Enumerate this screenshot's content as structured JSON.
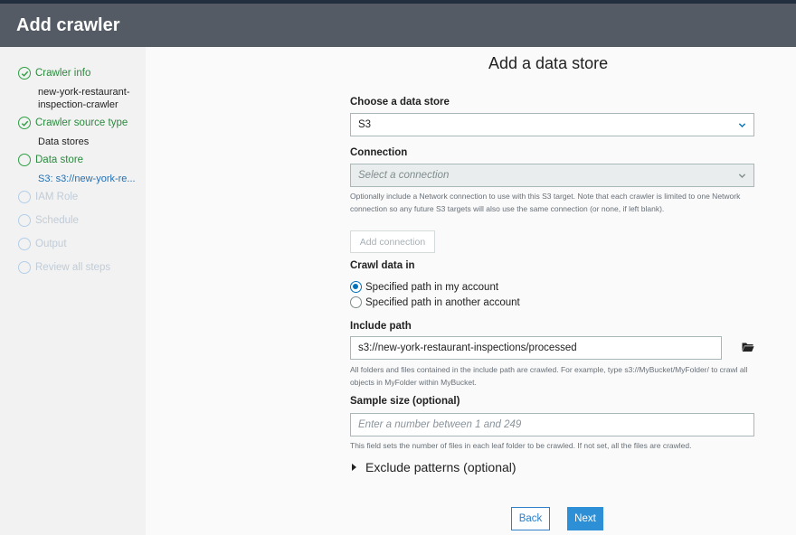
{
  "header": {
    "title": "Add crawler"
  },
  "sidebar": {
    "steps": [
      {
        "label": "Crawler info",
        "status": "done",
        "sub": "new-york-restaurant-inspection-crawler"
      },
      {
        "label": "Crawler source type",
        "status": "done",
        "sub": "Data stores"
      },
      {
        "label": "Data store",
        "status": "active",
        "sub": "S3: s3://new-york-re..."
      },
      {
        "label": "IAM Role",
        "status": "pending"
      },
      {
        "label": "Schedule",
        "status": "pending"
      },
      {
        "label": "Output",
        "status": "pending"
      },
      {
        "label": "Review all steps",
        "status": "pending"
      }
    ]
  },
  "main": {
    "title": "Add a data store",
    "data_store": {
      "label": "Choose a data store",
      "value": "S3"
    },
    "connection": {
      "label": "Connection",
      "placeholder": "Select a connection",
      "help": "Optionally include a Network connection to use with this S3 target. Note that each crawler is limited to one Network connection so any future S3 targets will also use the same connection (or none, if left blank).",
      "add_button": "Add connection"
    },
    "crawl": {
      "label": "Crawl data in",
      "options": [
        "Specified path in my account",
        "Specified path in another account"
      ],
      "selected": "Specified path in my account"
    },
    "include_path": {
      "label": "Include path",
      "value": "s3://new-york-restaurant-inspections/processed",
      "help": "All folders and files contained in the include path are crawled. For example, type s3://MyBucket/MyFolder/ to crawl all objects in MyFolder within MyBucket."
    },
    "sample_size": {
      "label": "Sample size (optional)",
      "placeholder": "Enter a number between 1 and 249",
      "help": "This field sets the number of files in each leaf folder to be crawled. If not set, all the files are crawled."
    },
    "exclude_label": "Exclude patterns (optional)",
    "buttons": {
      "back": "Back",
      "next": "Next"
    }
  },
  "colors": {
    "done_green": "#2ea043",
    "pending_blue": "#b4cfe9",
    "link_blue": "#1f6fb5",
    "primary": "#2d8fd5"
  },
  "icons": [
    "check-icon",
    "chevron-down-icon",
    "folder-icon",
    "caret-right-icon"
  ]
}
